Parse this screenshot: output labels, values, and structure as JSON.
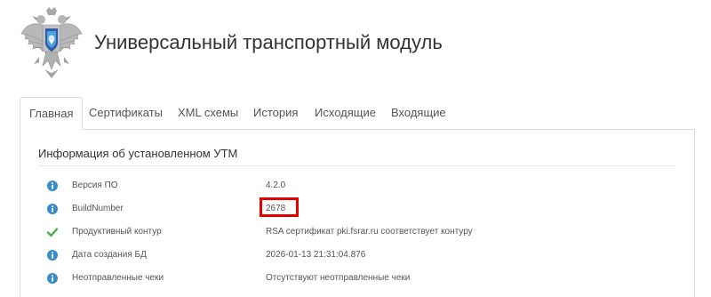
{
  "header": {
    "title": "Универсальный транспортный модуль",
    "logo_icon": "double-headed-eagle-emblem-icon"
  },
  "tabs": [
    {
      "label": "Главная",
      "active": true
    },
    {
      "label": "Сертификаты",
      "active": false
    },
    {
      "label": "XML схемы",
      "active": false
    },
    {
      "label": "История",
      "active": false
    },
    {
      "label": "Исходящие",
      "active": false
    },
    {
      "label": "Входящие",
      "active": false
    }
  ],
  "main": {
    "section_title": "Информация об установленном УТМ",
    "rows": [
      {
        "icon": "info-icon",
        "label": "Версия ПО",
        "value": "4.2.0"
      },
      {
        "icon": "info-icon",
        "label": "BuildNumber",
        "value": "2678",
        "highlighted": true
      },
      {
        "icon": "check-icon",
        "label": "Продуктивный контур",
        "value": "RSA сертификат pki.fsrar.ru соответствует контуру"
      },
      {
        "icon": "info-icon",
        "label": "Дата создания БД",
        "value": "2026-01-13 21:31:04.876"
      },
      {
        "icon": "info-icon",
        "label": "Неотправленные чеки",
        "value": "Отсутствуют неотправленные чеки"
      }
    ]
  },
  "colors": {
    "info_icon": "#3a8cc9",
    "check_icon": "#4cae4c",
    "highlight": "#e00000",
    "border": "#dddddd"
  }
}
